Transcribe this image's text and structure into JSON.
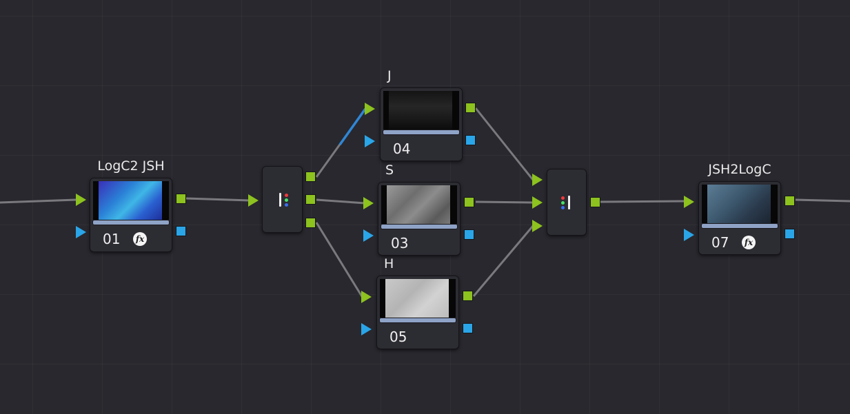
{
  "nodes": [
    {
      "id": "01",
      "title": "LogC2 JSH",
      "number": "01",
      "fx": true,
      "fx_label": "fx"
    },
    {
      "id": "04",
      "title": "J",
      "number": "04",
      "fx": false
    },
    {
      "id": "03",
      "title": "S",
      "number": "03",
      "fx": false
    },
    {
      "id": "05",
      "title": "H",
      "number": "05",
      "fx": false
    },
    {
      "id": "07",
      "title": "JSH2LogC",
      "number": "07",
      "fx": true,
      "fx_label": "fx"
    }
  ],
  "colors": {
    "background": "#28282e",
    "rgb_input": "#8dc21f",
    "key_input": "#2aa5e8",
    "connection": "#7a7a7e",
    "selected_connection": "#2f86d6",
    "node_bar": "#8fa3c7"
  },
  "icons": {
    "splitter": "splitter-rgb-icon",
    "combiner": "combiner-rgb-icon",
    "fx": "fx-icon"
  }
}
